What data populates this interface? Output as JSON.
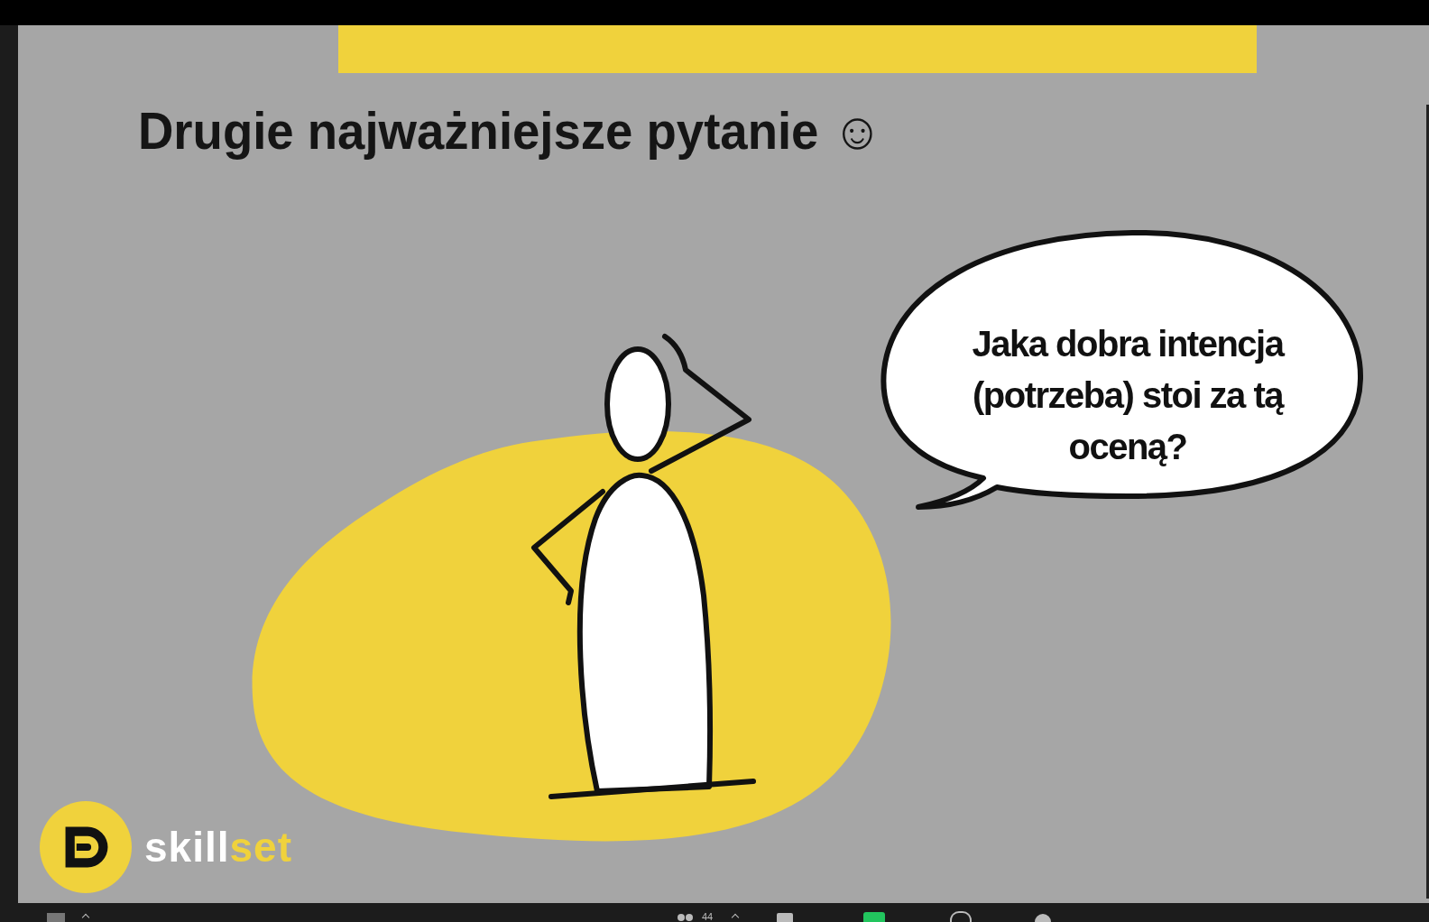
{
  "slide": {
    "title": "Drugie najważniejsze pytanie ☺",
    "speech_bubble": "Jaka dobra intencja (potrzeba) stoi za tą oceną?",
    "logo": {
      "text_primary": "skill",
      "text_accent": "set"
    }
  },
  "toolbar": {
    "participant_count": "44"
  }
}
